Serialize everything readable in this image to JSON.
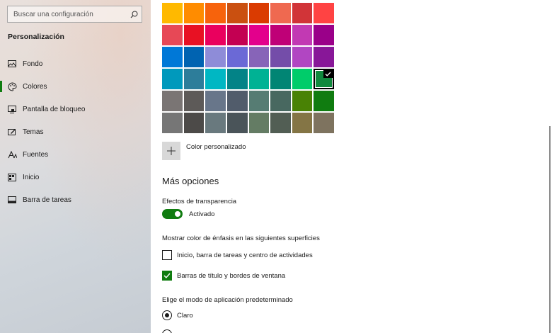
{
  "sidebar": {
    "search_placeholder": "Buscar una configuración",
    "section_title": "Personalización",
    "items": [
      {
        "label": "Fondo",
        "icon": "image-icon"
      },
      {
        "label": "Colores",
        "icon": "palette-icon"
      },
      {
        "label": "Pantalla de bloqueo",
        "icon": "lock-screen-icon"
      },
      {
        "label": "Temas",
        "icon": "themes-icon"
      },
      {
        "label": "Fuentes",
        "icon": "fonts-icon"
      },
      {
        "label": "Inicio",
        "icon": "start-icon"
      },
      {
        "label": "Barra de tareas",
        "icon": "taskbar-icon"
      }
    ],
    "selected_item": "Colores"
  },
  "colors": {
    "accent": "#107c10",
    "swatches": [
      [
        "#ffb900",
        "#ff8c00",
        "#f7630c",
        "#ca5010",
        "#da3b01",
        "#ef6950",
        "#d13438",
        "#ff4343"
      ],
      [
        "#e74856",
        "#e81123",
        "#ea005e",
        "#c30052",
        "#e3008c",
        "#bf0077",
        "#c239b3",
        "#9a0089"
      ],
      [
        "#0078d7",
        "#0063b1",
        "#8e8cd8",
        "#6b69d6",
        "#8764b8",
        "#744da9",
        "#b146c2",
        "#881798"
      ],
      [
        "#0099bc",
        "#2d7d9a",
        "#00b7c3",
        "#038387",
        "#00b294",
        "#018574",
        "#00cc6a",
        "#10893e"
      ],
      [
        "#7a7574",
        "#5d5a58",
        "#68768a",
        "#515c6b",
        "#567c73",
        "#486860",
        "#498205",
        "#107c10"
      ],
      [
        "#767676",
        "#4c4a48",
        "#69797e",
        "#4a5459",
        "#647c64",
        "#525e54",
        "#847545",
        "#7e735f"
      ]
    ],
    "selected_swatch": "#10893e"
  },
  "main": {
    "custom_color_label": "Color personalizado",
    "more_options_title": "Más opciones",
    "transparency_label": "Efectos de transparencia",
    "transparency_state": "Activado",
    "accent_surfaces_label": "Mostrar color de énfasis en las siguientes superficies",
    "checkbox_start": "Inicio, barra de tareas y centro de actividades",
    "checkbox_start_checked": false,
    "checkbox_titlebars": "Barras de título y bordes de ventana",
    "checkbox_titlebars_checked": true,
    "app_mode_label": "Elige el modo de aplicación predeterminado",
    "radio_light": "Claro",
    "radio_light_selected": true
  }
}
